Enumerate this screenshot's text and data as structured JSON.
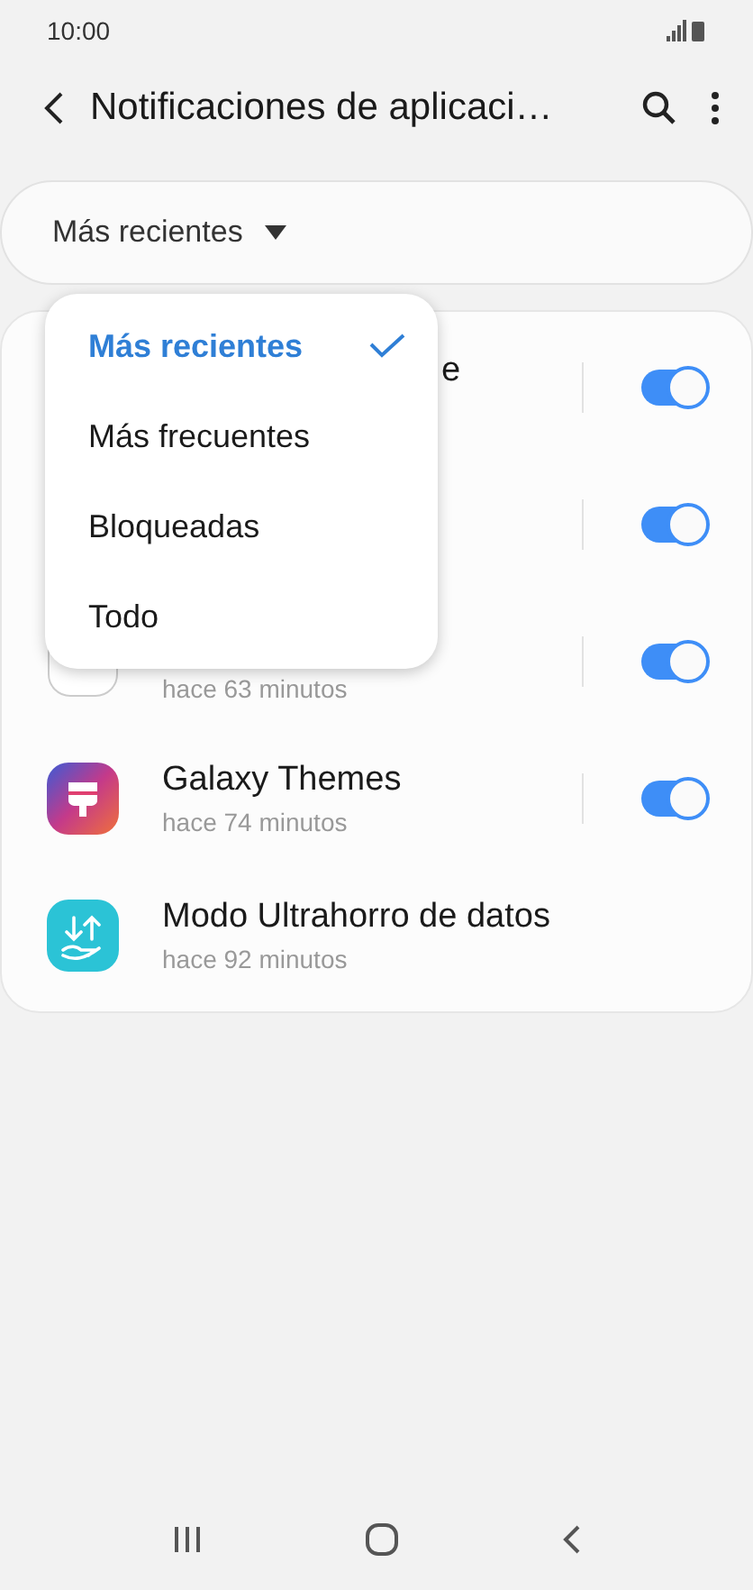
{
  "status_bar": {
    "time": "10:00"
  },
  "header": {
    "title": "Notificaciones de aplicaci…"
  },
  "filter": {
    "label": "Más recientes"
  },
  "apps": [
    {
      "title": "e",
      "on": true
    },
    {
      "on": true
    },
    {
      "subtitle": "hace 63 minutos",
      "kind": "generic",
      "on": true
    },
    {
      "title": "Galaxy Themes",
      "subtitle": "hace 74 minutos",
      "kind": "themes",
      "on": true
    },
    {
      "title": "Modo Ultrahorro de datos",
      "subtitle": "hace 92 minutos",
      "kind": "datasaver"
    }
  ],
  "menu": [
    {
      "label": "Más recientes",
      "selected": true
    },
    {
      "label": "Más frecuentes",
      "selected": false
    },
    {
      "label": "Bloqueadas",
      "selected": false
    },
    {
      "label": "Todo",
      "selected": false
    }
  ]
}
